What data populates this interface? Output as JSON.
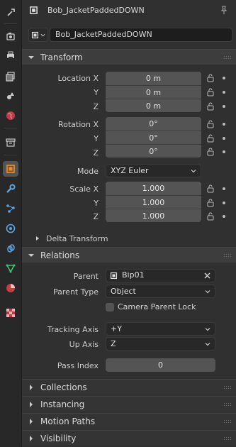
{
  "header": {
    "object_name": "Bob_JacketPaddedDOWN"
  },
  "name_field": {
    "value": "Bob_JacketPaddedDOWN"
  },
  "tabs": [
    {
      "icon": "tool-icon"
    },
    {
      "icon": "render-icon"
    },
    {
      "icon": "output-icon"
    },
    {
      "icon": "view-layer-icon"
    },
    {
      "icon": "scene-icon"
    },
    {
      "icon": "world-icon"
    },
    {
      "icon": "collection-icon"
    },
    {
      "icon": "object-icon"
    },
    {
      "icon": "modifier-wrench-icon"
    },
    {
      "icon": "particles-icon"
    },
    {
      "icon": "physics-icon"
    },
    {
      "icon": "constraints-icon"
    },
    {
      "icon": "data-icon"
    },
    {
      "icon": "material-icon"
    },
    {
      "icon": "texture-icon"
    }
  ],
  "transform": {
    "title": "Transform",
    "location": {
      "label_x": "Location X",
      "label_y": "Y",
      "label_z": "Z",
      "x": "0 m",
      "y": "0 m",
      "z": "0 m"
    },
    "rotation": {
      "label_x": "Rotation X",
      "label_y": "Y",
      "label_z": "Z",
      "x": "0°",
      "y": "0°",
      "z": "0°"
    },
    "mode": {
      "label": "Mode",
      "value": "XYZ Euler"
    },
    "scale": {
      "label_x": "Scale X",
      "label_y": "Y",
      "label_z": "Z",
      "x": "1.000",
      "y": "1.000",
      "z": "1.000"
    },
    "delta_label": "Delta Transform"
  },
  "relations": {
    "title": "Relations",
    "parent": {
      "label": "Parent",
      "value": "Bip01"
    },
    "parent_type": {
      "label": "Parent Type",
      "value": "Object"
    },
    "camera_parent_lock": {
      "label": "Camera Parent Lock",
      "checked": false
    },
    "tracking_axis": {
      "label": "Tracking Axis",
      "value": "+Y"
    },
    "up_axis": {
      "label": "Up Axis",
      "value": "Z"
    },
    "pass_index": {
      "label": "Pass Index",
      "value": "0"
    }
  },
  "collapsed_panels": {
    "collections": "Collections",
    "instancing": "Instancing",
    "motion_paths": "Motion Paths",
    "visibility": "Visibility"
  },
  "colors": {
    "accent": "#ff8c19",
    "background": "#303030",
    "field": "#545454"
  }
}
